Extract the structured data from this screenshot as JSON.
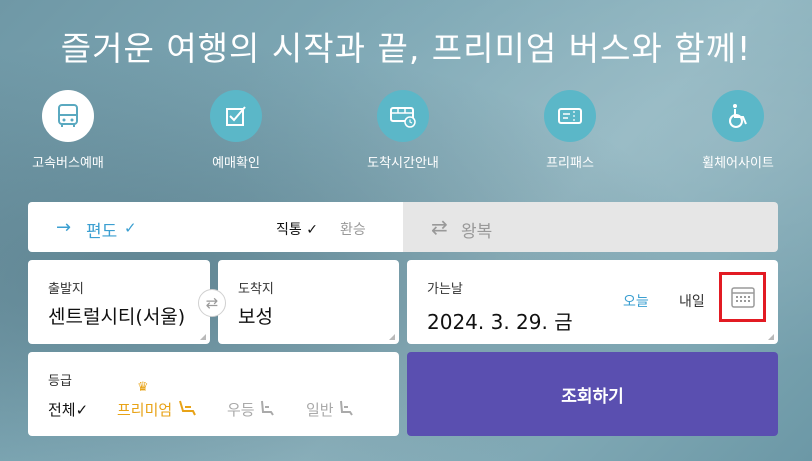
{
  "hero": {
    "title": "즐거운 여행의 시작과 끝, 프리미엄 버스와 함께!"
  },
  "nav": [
    {
      "label": "고속버스예매",
      "icon": "bus-icon"
    },
    {
      "label": "예매확인",
      "icon": "checkbox-icon"
    },
    {
      "label": "도착시간안내",
      "icon": "bus-clock-icon"
    },
    {
      "label": "프리패스",
      "icon": "ticket-icon"
    },
    {
      "label": "휠체어사이트",
      "icon": "wheelchair-icon"
    }
  ],
  "trip": {
    "oneway_label": "편도",
    "oneway_check": "✓",
    "direct_label": "직통",
    "direct_check": "✓",
    "transfer_label": "환승",
    "round_label": "왕복"
  },
  "route": {
    "departure_label": "출발지",
    "departure_value": "센트럴시티(서울)",
    "arrival_label": "도착지",
    "arrival_value": "보성"
  },
  "date": {
    "label": "가는날",
    "value": "2024. 3. 29. 금",
    "today_label": "오늘",
    "tomorrow_label": "내일"
  },
  "grade": {
    "label": "등급",
    "all_label": "전체",
    "all_check": "✓",
    "premium_label": "프리미엄",
    "excellent_label": "우등",
    "normal_label": "일반"
  },
  "search": {
    "button_label": "조회하기"
  },
  "colors": {
    "accent": "#3b9fd1",
    "search_bg": "#5a4fb0",
    "premium": "#e8a317",
    "highlight_box": "#e21b23",
    "nav_circle": "#5bb7c8"
  }
}
